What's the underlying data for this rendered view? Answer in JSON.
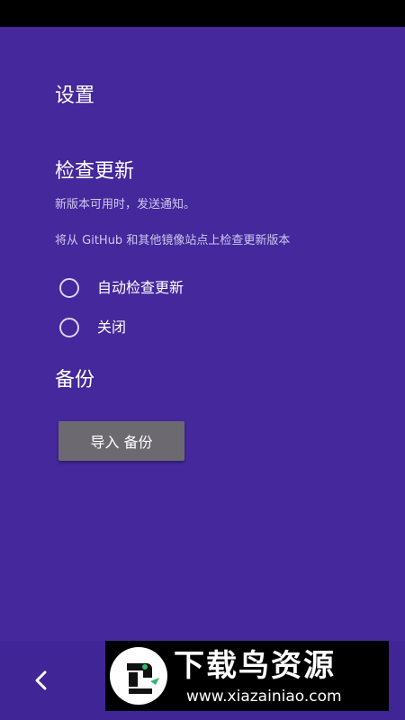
{
  "header": {
    "title": "设置"
  },
  "update_section": {
    "title": "检查更新",
    "description": "新版本可用时，发送通知。",
    "source_note": "将从 GitHub 和其他镜像站点上检查更新版本",
    "options": [
      {
        "label": "自动检查更新",
        "selected": false
      },
      {
        "label": "关闭",
        "selected": false
      }
    ]
  },
  "backup_section": {
    "title": "备份",
    "import_button_label": "导入 备份"
  },
  "navigation": {
    "back_icon": "chevron-left-icon"
  },
  "watermark": {
    "title": "下载鸟资源",
    "url": "www.xiazainiao.com"
  },
  "colors": {
    "background": "#44289c",
    "status_bar": "#000000",
    "button": "#6c6a70",
    "text_secondary": "#cfc8ee"
  }
}
